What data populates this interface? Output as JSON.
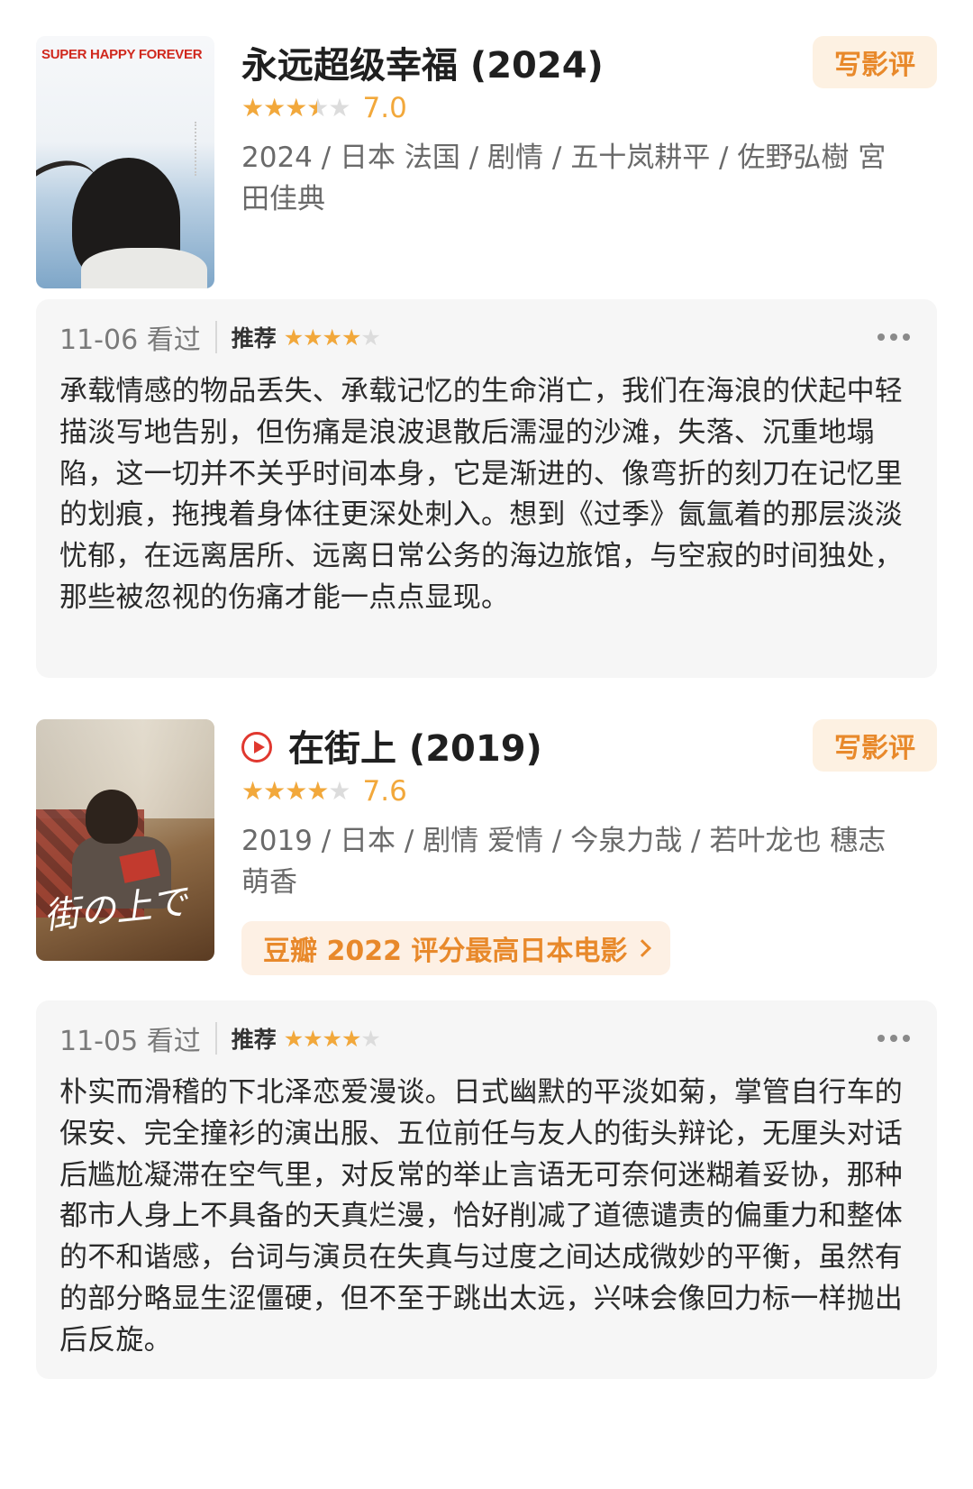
{
  "movies": [
    {
      "poster_title": "SUPER HAPPY FOREVER",
      "title": "永远超级幸福 (2024)",
      "rating_value": 3.5,
      "score": "7.0",
      "meta": "2024 / 日本 法国 / 剧情 / 五十岚耕平 / 佐野弘樹 宮田佳典",
      "write_review": "写影评",
      "review": {
        "date": "11-06 看过",
        "tag": "推荐",
        "user_stars": 4,
        "text": "承载情感的物品丢失、承载记忆的生命消亡，我们在海浪的伏起中轻描淡写地告别，但伤痛是浪波退散后濡湿的沙滩，失落、沉重地塌陷，这一切并不关乎时间本身，它是渐进的、像弯折的刻刀在记忆里的划痕，拖拽着身体往更深处刺入。想到《过季》氤氲着的那层淡淡忧郁，在远离居所、远离日常公务的海边旅馆，与空寂的时间独处，那些被忽视的伤痛才能一点点显现。"
      }
    },
    {
      "poster_script": "街の上で",
      "title": "在街上 (2019)",
      "rating_value": 4,
      "score": "7.6",
      "meta": "2019 / 日本 / 剧情 爱情 / 今泉力哉 / 若叶龙也 穗志萌香",
      "write_review": "写影评",
      "promo": "豆瓣 2022 评分最高日本电影",
      "review": {
        "date": "11-05 看过",
        "tag": "推荐",
        "user_stars": 4,
        "text": "朴实而滑稽的下北泽恋爱漫谈。日式幽默的平淡如菊，掌管自行车的保安、完全撞衫的演出服、五位前任与友人的街头辩论，无厘头对话后尴尬凝滞在空气里，对反常的举止言语无可奈何迷糊着妥协，那种都市人身上不具备的天真烂漫，恰好削减了道德谴责的偏重力和整体的不和谐感，台词与演员在失真与过度之间达成微妙的平衡，虽然有的部分略显生涩僵硬，但不至于跳出太远，兴味会像回力标一样抛出后反旋。"
      }
    }
  ],
  "colors": {
    "accent": "#f2a83b",
    "button_text": "#e8892b",
    "button_bg": "#fdf1e2",
    "play": "#e0382f"
  }
}
